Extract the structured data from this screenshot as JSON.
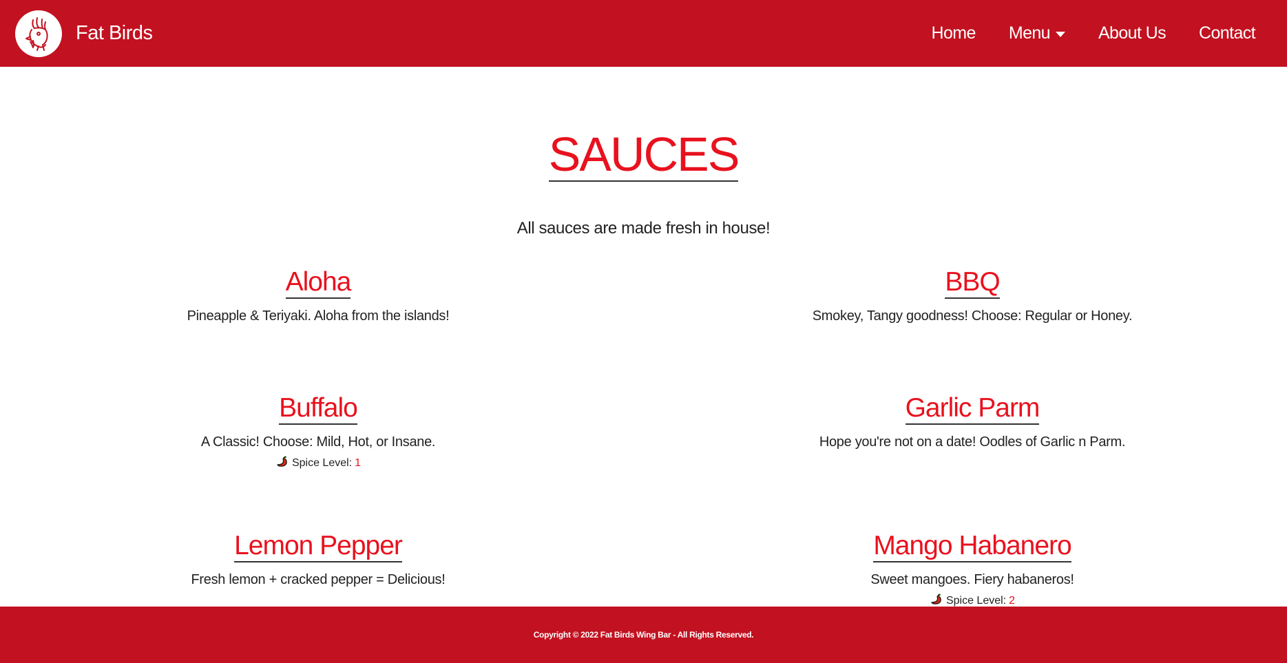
{
  "navbar": {
    "brand": "Fat Birds",
    "links": {
      "home": "Home",
      "menu": "Menu",
      "about": "About Us",
      "contact": "Contact"
    }
  },
  "page": {
    "title": "SAUCES",
    "subtitle": "All sauces are made fresh in house!"
  },
  "sauces": [
    {
      "name": "Aloha",
      "description": "Pineapple & Teriyaki. Aloha from the islands!"
    },
    {
      "name": "BBQ",
      "description": "Smokey, Tangy goodness! Choose: Regular or Honey."
    },
    {
      "name": "Buffalo",
      "description": "A Classic! Choose: Mild, Hot, or Insane.",
      "spice_label": "Spice Level:",
      "spice_level": "1"
    },
    {
      "name": "Garlic Parm",
      "description": "Hope you're not on a date! Oodles of Garlic n Parm."
    },
    {
      "name": "Lemon Pepper",
      "description": "Fresh lemon + cracked pepper = Delicious!"
    },
    {
      "name": "Mango Habanero",
      "description": "Sweet mangoes. Fiery habaneros!",
      "spice_label": "Spice Level:",
      "spice_level": "2"
    }
  ],
  "footer": {
    "copyright": "Copyright © 2022 Fat Birds Wing Bar - All Rights Reserved."
  },
  "colors": {
    "brand_red": "#c21120",
    "title_red": "#e8121e"
  },
  "icons": {
    "logo": "rooster-logo",
    "spice": "chili-pepper-icon"
  }
}
